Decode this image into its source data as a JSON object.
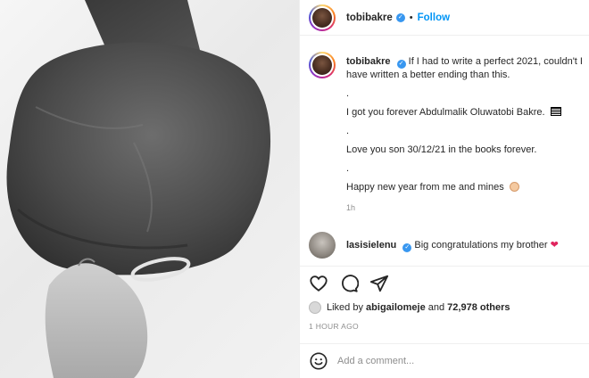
{
  "post_header": {
    "username": "tobibakre",
    "separator": "•",
    "follow_label": "Follow"
  },
  "caption": {
    "username": "tobibakre",
    "lines": [
      "If I had to write a perfect 2021, couldn't I have written a better ending than this.",
      ".",
      "I got you forever Abdulmalik Oluwatobi Bakre.",
      ".",
      "Love you son 30/12/21 in the books forever.",
      ".",
      "Happy new year from me and mines"
    ],
    "time": "1h"
  },
  "comment": {
    "username": "lasisielenu",
    "text": "Big congratulations my brother"
  },
  "likes": {
    "prefix": "Liked by",
    "user": "abigailomeje",
    "mid": "and",
    "count": "72,978 others"
  },
  "time_ago": "1 HOUR AGO",
  "add_comment": {
    "placeholder": "Add a comment..."
  },
  "icons": {
    "like": "heart-icon",
    "comment": "comment-icon",
    "share": "share-icon",
    "emoji": "smile-icon",
    "verified": "verified-badge-icon"
  },
  "colors": {
    "follow": "#0095f6",
    "verified": "#3897f0",
    "muted": "#8e8e8e"
  }
}
